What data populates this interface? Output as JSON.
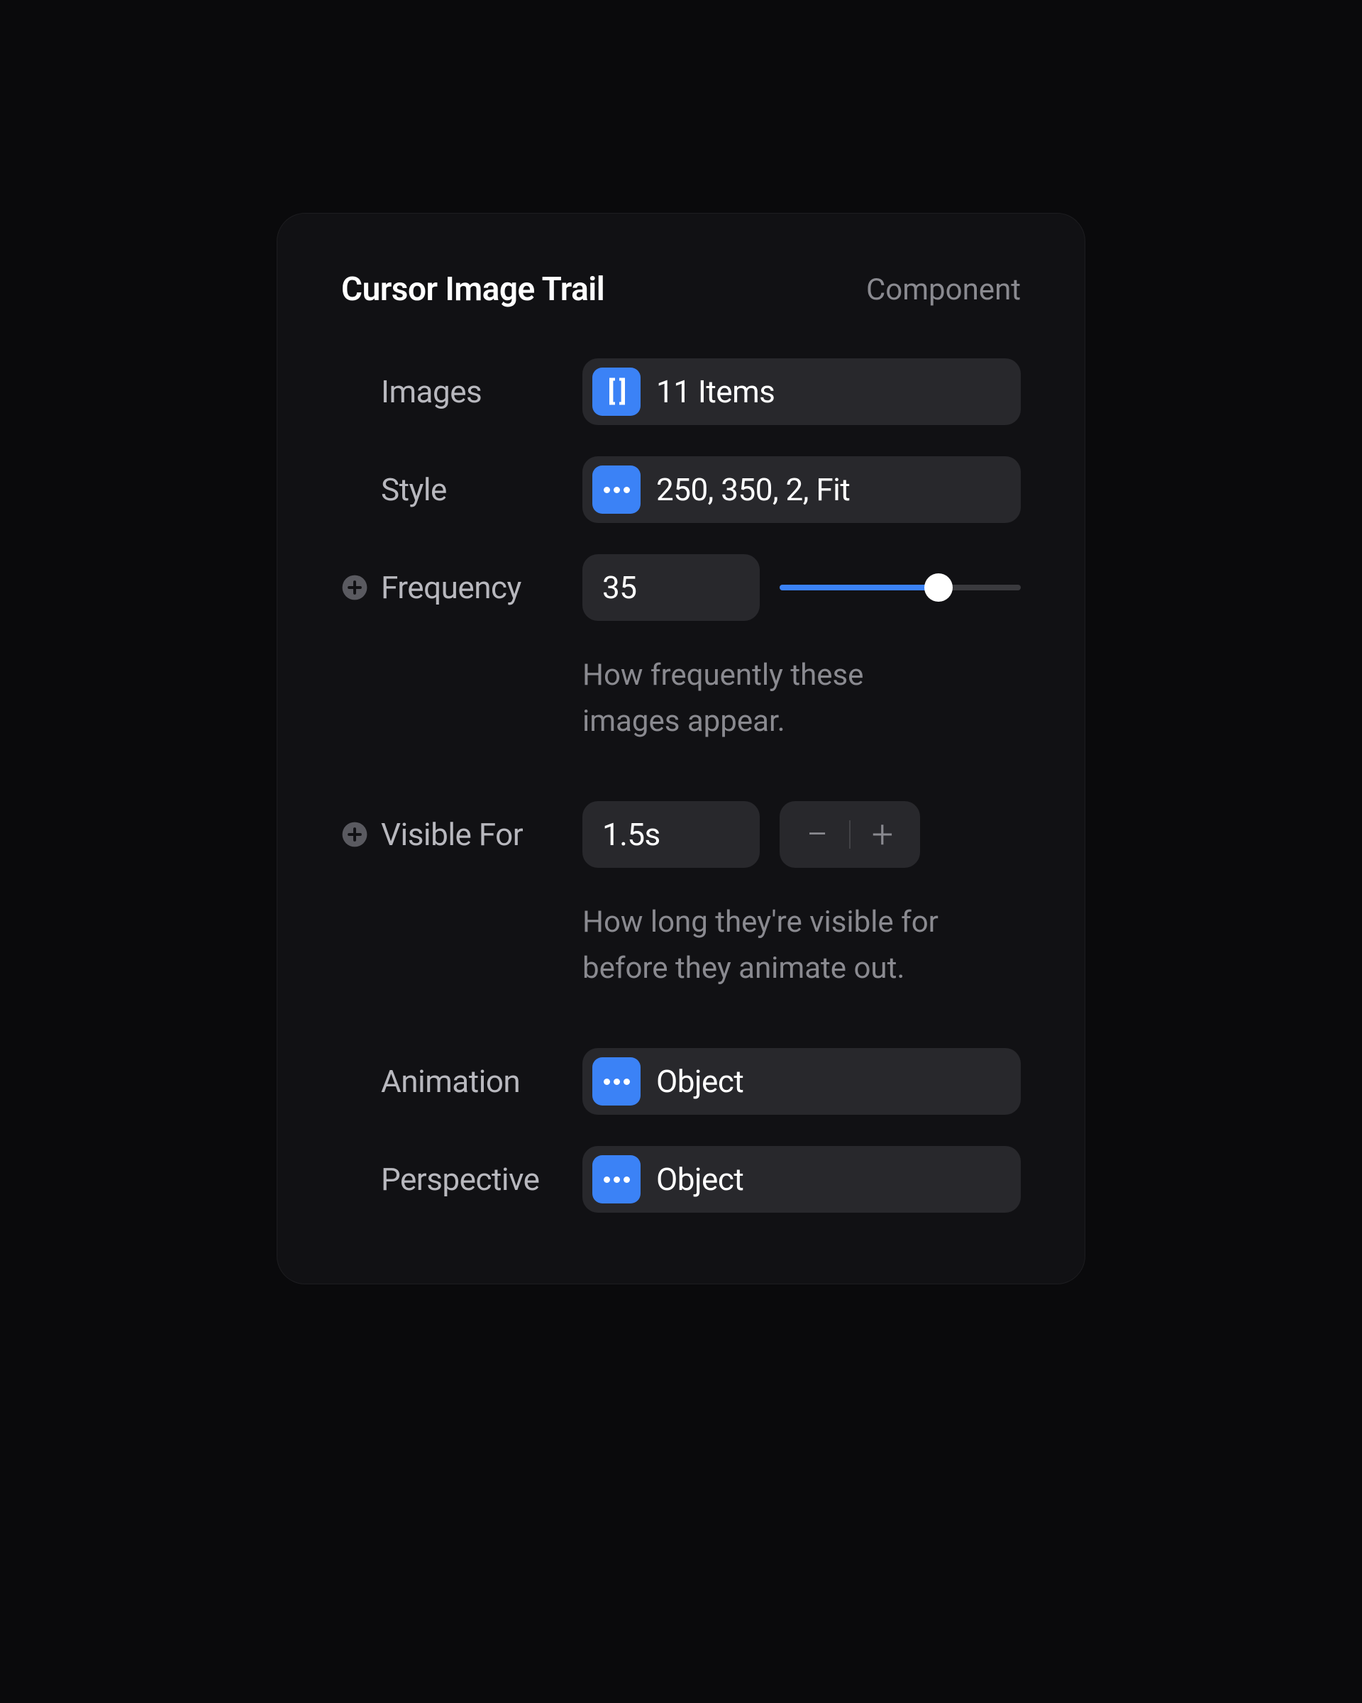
{
  "panel": {
    "title": "Cursor Image Trail",
    "type": "Component"
  },
  "images": {
    "label": "Images",
    "value": "11 Items"
  },
  "style": {
    "label": "Style",
    "value": "250, 350, 2, Fit"
  },
  "frequency": {
    "label": "Frequency",
    "value": "35",
    "slider_percent": 66,
    "help": "How frequently these images appear."
  },
  "visible_for": {
    "label": "Visible For",
    "value": "1.5s",
    "help": "How long they're visible for before they animate out."
  },
  "animation": {
    "label": "Animation",
    "value": "Object"
  },
  "perspective": {
    "label": "Perspective",
    "value": "Object"
  }
}
